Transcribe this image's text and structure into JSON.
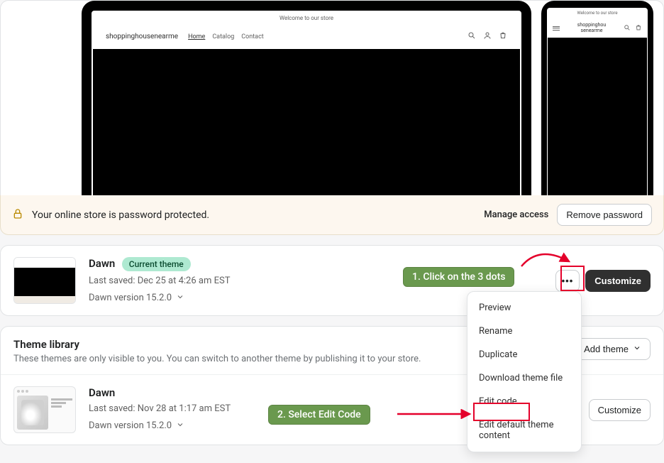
{
  "preview": {
    "banner": "Welcome to our store",
    "site_title": "shoppinghousenearme",
    "site_title_mobile_l1": "shoppinghou",
    "site_title_mobile_l2": "senearme",
    "nav": {
      "home": "Home",
      "catalog": "Catalog",
      "contact": "Contact"
    }
  },
  "password_bar": {
    "text": "Your online store is password protected.",
    "manage": "Manage access",
    "remove": "Remove password"
  },
  "current_theme": {
    "name": "Dawn",
    "badge": "Current theme",
    "saved": "Last saved: Dec 25 at 4:26 am EST",
    "version": "Dawn version 15.2.0",
    "dots": "•••",
    "customize": "Customize"
  },
  "library": {
    "title": "Theme library",
    "subtitle": "These themes are only visible to you. You can switch to another theme by publishing it to your store.",
    "add": "Add theme"
  },
  "library_theme": {
    "name": "Dawn",
    "saved": "Last saved: Nov 28 at 1:17 am EST",
    "version": "Dawn version 15.2.0",
    "customize": "Customize"
  },
  "menu": {
    "preview": "Preview",
    "rename": "Rename",
    "duplicate": "Duplicate",
    "download": "Download theme file",
    "edit_code": "Edit code",
    "edit_content": "Edit default theme content"
  },
  "annotations": {
    "step1": "1. Click on the 3 dots",
    "step2": "2. Select Edit Code"
  }
}
